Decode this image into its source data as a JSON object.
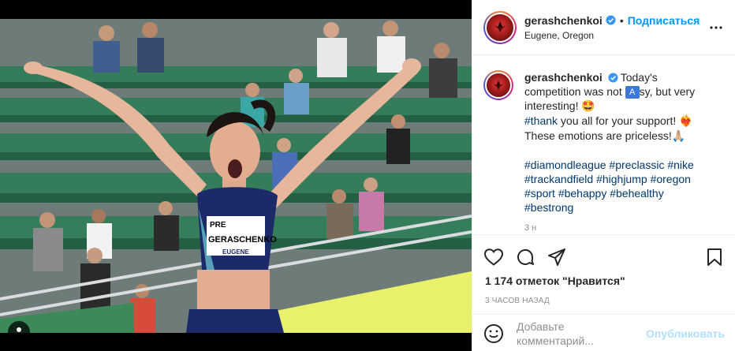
{
  "post": {
    "username": "gerashchenkoi",
    "follow_label": "Подписаться",
    "location": "Eugene, Oregon",
    "caption": {
      "username": "gerashchenkoi",
      "line1": "Today's competition was not",
      "line1_cont": "sy, but very interesting!",
      "emoji1": "🤩",
      "tag_thank": "#thank",
      "line2": " you all for your support!",
      "emoji2": "❤️‍🔥",
      "line3": "These emotions are priceless!",
      "emoji3": "🙏🏼",
      "hashtags": [
        "#diamondleague",
        "#preclassic",
        "#nike",
        "#trackandfield",
        "#highjump",
        "#oregon",
        "#sport",
        "#behappy",
        "#behealthy",
        "#bestrong"
      ],
      "translate_icon_label": "A",
      "age": "3 н"
    },
    "likes_text": "1 174 отметок \"Нравится\"",
    "time_text": "3 ЧАСОВ НАЗАД",
    "comment_placeholder": "Добавьте комментарий...",
    "publish_label": "Опубликовать",
    "photo": {
      "bib_top": "PRE",
      "bib_name": "GERASCHENKO",
      "bib_bottom": "EUGENE"
    }
  },
  "icons": {
    "verified": "verified-badge-icon",
    "more": "more-options-icon",
    "like": "heart-icon",
    "comment": "comment-icon",
    "share": "share-icon",
    "save": "bookmark-icon",
    "emoji": "smile-icon",
    "user_tag": "user-tag-icon"
  },
  "colors": {
    "accent_blue": "#0095f6",
    "hashtag": "#00376b",
    "muted": "#8e8e8e",
    "publish_disabled": "#b2dffc"
  }
}
